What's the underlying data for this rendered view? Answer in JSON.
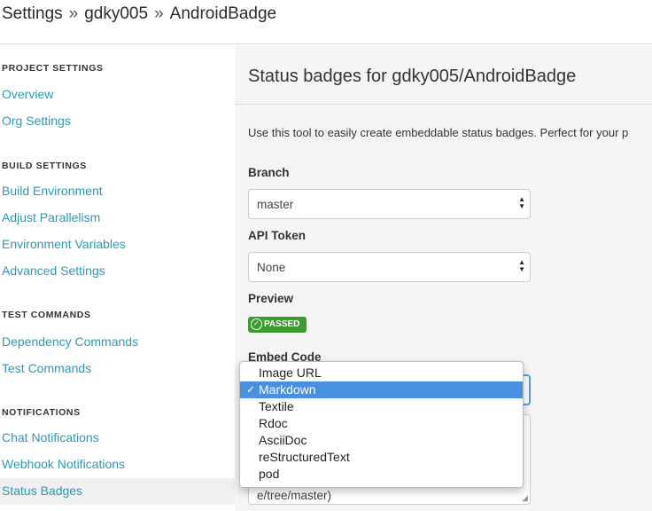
{
  "breadcrumb": {
    "items": [
      "Settings",
      "gdky005",
      "AndroidBadge"
    ],
    "separator": "»"
  },
  "sidebar": {
    "sections": [
      {
        "title": "PROJECT SETTINGS",
        "items": [
          "Overview",
          "Org Settings"
        ]
      },
      {
        "title": "BUILD SETTINGS",
        "items": [
          "Build Environment",
          "Adjust Parallelism",
          "Environment Variables",
          "Advanced Settings"
        ]
      },
      {
        "title": "TEST COMMANDS",
        "items": [
          "Dependency Commands",
          "Test Commands"
        ]
      },
      {
        "title": "NOTIFICATIONS",
        "items": [
          "Chat Notifications",
          "Webhook Notifications",
          "Status Badges"
        ]
      }
    ],
    "active_item": "Status Badges"
  },
  "main": {
    "title": "Status badges for gdky005/AndroidBadge",
    "description": "Use this tool to easily create embeddable status badges. Perfect for your p",
    "branch": {
      "label": "Branch",
      "value": "master"
    },
    "api_token": {
      "label": "API Token",
      "value": "None"
    },
    "preview": {
      "label": "Preview",
      "badge_text": "PASSED"
    },
    "embed": {
      "label": "Embed Code",
      "code_tail": "e/tree/master)"
    }
  },
  "dropdown": {
    "options": [
      "Image URL",
      "Markdown",
      "Textile",
      "Rdoc",
      "AsciiDoc",
      "reStructuredText",
      "pod"
    ],
    "selected": "Markdown",
    "check_glyph": "✓"
  },
  "colors": {
    "link": "#2a9bb3",
    "badge": "#3c9c30",
    "highlight": "#4a90e2",
    "focus": "#5a9bd8"
  }
}
